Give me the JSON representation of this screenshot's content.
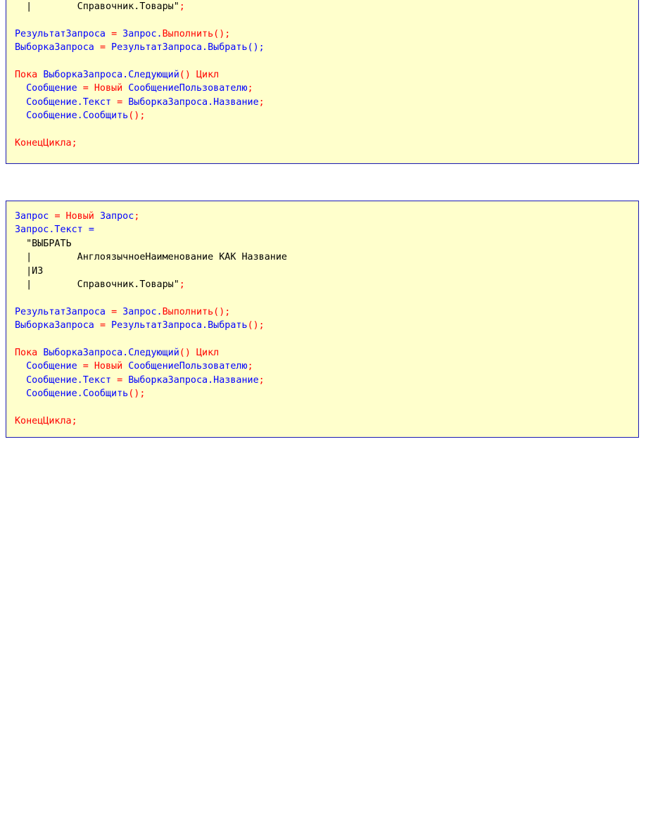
{
  "colors": {
    "background": "#ffffcc",
    "border": "#1a1ab0",
    "identifier": "#0000ff",
    "keyword": "#ff0000",
    "string": "#000000"
  },
  "blocks": [
    {
      "lines": [
        [
          {
            "t": "  |        Справочник.Товары\"",
            "c": "k"
          },
          {
            "t": ";",
            "c": "r"
          }
        ],
        [],
        [
          {
            "t": "РезультатЗапроса ",
            "c": "b"
          },
          {
            "t": "=",
            "c": "r"
          },
          {
            "t": " Запрос.",
            "c": "b"
          },
          {
            "t": "Выполнить();",
            "c": "r"
          }
        ],
        [
          {
            "t": "ВыборкаЗапроса ",
            "c": "b"
          },
          {
            "t": "=",
            "c": "r"
          },
          {
            "t": " РезультатЗапроса.",
            "c": "b"
          },
          {
            "t": "Выбрать();",
            "c": "b"
          }
        ],
        [],
        [
          {
            "t": "Пока ",
            "c": "r"
          },
          {
            "t": "ВыборкаЗапроса.Следующий",
            "c": "b"
          },
          {
            "t": "() Цикл",
            "c": "r"
          }
        ],
        [
          {
            "t": "  Сообщение ",
            "c": "b"
          },
          {
            "t": "=",
            "c": "r"
          },
          {
            "t": " Новый ",
            "c": "r"
          },
          {
            "t": "СообщениеПользователю",
            "c": "b"
          },
          {
            "t": ";",
            "c": "r"
          }
        ],
        [
          {
            "t": "  Сообщение.Текст ",
            "c": "b"
          },
          {
            "t": "=",
            "c": "r"
          },
          {
            "t": " ВыборкаЗапроса.Название",
            "c": "b"
          },
          {
            "t": ";",
            "c": "r"
          }
        ],
        [
          {
            "t": "  Сообщение.Сообщить",
            "c": "b"
          },
          {
            "t": "();",
            "c": "r"
          }
        ],
        [],
        [
          {
            "t": "КонецЦикла;",
            "c": "r"
          }
        ]
      ]
    },
    {
      "lines": [
        [
          {
            "t": "Запрос ",
            "c": "b"
          },
          {
            "t": "=",
            "c": "r"
          },
          {
            "t": " Новый ",
            "c": "r"
          },
          {
            "t": "Запрос",
            "c": "b"
          },
          {
            "t": ";",
            "c": "r"
          }
        ],
        [
          {
            "t": "Запрос.Текст ",
            "c": "b"
          },
          {
            "t": "=",
            "c": "b"
          }
        ],
        [
          {
            "t": "  \"ВЫБРАТЬ",
            "c": "k"
          }
        ],
        [
          {
            "t": "  |        АнглоязычноеНаименование КАК Название",
            "c": "k"
          }
        ],
        [
          {
            "t": "  |ИЗ",
            "c": "k"
          }
        ],
        [
          {
            "t": "  |        Справочник.Товары\"",
            "c": "k"
          },
          {
            "t": ";",
            "c": "r"
          }
        ],
        [],
        [
          {
            "t": "РезультатЗапроса ",
            "c": "b"
          },
          {
            "t": "=",
            "c": "r"
          },
          {
            "t": " Запрос.",
            "c": "b"
          },
          {
            "t": "Выполнить();",
            "c": "r"
          }
        ],
        [
          {
            "t": "ВыборкаЗапроса ",
            "c": "b"
          },
          {
            "t": "=",
            "c": "r"
          },
          {
            "t": " РезультатЗапроса.",
            "c": "b"
          },
          {
            "t": "Выбрать",
            "c": "b"
          },
          {
            "t": "();",
            "c": "r"
          }
        ],
        [],
        [
          {
            "t": "Пока ",
            "c": "r"
          },
          {
            "t": "ВыборкаЗапроса.Следующий",
            "c": "b"
          },
          {
            "t": "() Цикл",
            "c": "r"
          }
        ],
        [
          {
            "t": "  Сообщение ",
            "c": "b"
          },
          {
            "t": "=",
            "c": "r"
          },
          {
            "t": " Новый ",
            "c": "r"
          },
          {
            "t": "СообщениеПользователю",
            "c": "b"
          },
          {
            "t": ";",
            "c": "r"
          }
        ],
        [
          {
            "t": "  Сообщение.Текст ",
            "c": "b"
          },
          {
            "t": "=",
            "c": "r"
          },
          {
            "t": " ВыборкаЗапроса.Название",
            "c": "b"
          },
          {
            "t": ";",
            "c": "r"
          }
        ],
        [
          {
            "t": "  Сообщение.Сообщить",
            "c": "b"
          },
          {
            "t": "();",
            "c": "r"
          }
        ],
        [],
        [
          {
            "t": "КонецЦикла;",
            "c": "r"
          }
        ]
      ]
    }
  ]
}
